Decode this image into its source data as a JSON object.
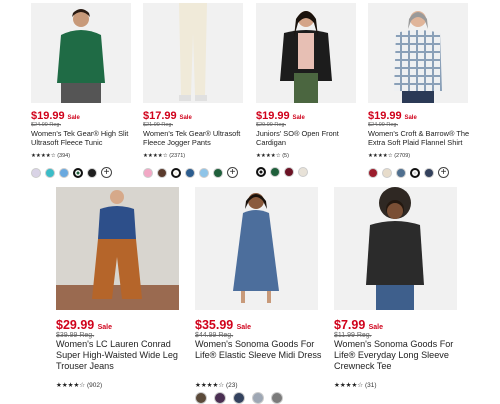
{
  "products": [
    {
      "price": "$19.99",
      "sale": "Sale",
      "regular": "$24.99 Reg.",
      "name": "Women's Tek Gear® High Slit Ultrasoft Fleece Tunic",
      "stars": "★★★★☆",
      "reviews": "(394)",
      "swatches": [
        "#d9d3e6",
        "#3bbcc7",
        "#6aa9df",
        "#1f5f3b",
        "#1e1e1e"
      ],
      "selected": 3,
      "more": true
    },
    {
      "price": "$17.99",
      "sale": "Sale",
      "regular": "$21.99 Reg.",
      "name": "Women's Tek Gear® Ultrasoft Fleece Jogger Pants",
      "stars": "★★★★☆",
      "reviews": "(2371)",
      "swatches": [
        "#f2a8c5",
        "#5a3a2c",
        "#f1ece0",
        "#2c5d8f",
        "#8ec4e8",
        "#1f5f3b"
      ],
      "selected": 2,
      "more": true
    },
    {
      "price": "$19.99",
      "sale": "Sale",
      "regular": "$29.99 Reg.",
      "name": "Juniors' SO® Open Front Cardigan",
      "stars": "★★★★☆",
      "reviews": "(5)",
      "swatches": [
        "#141414",
        "#1f5f3b",
        "#6b1224",
        "#e8e2d8"
      ],
      "selected": 0,
      "more": false
    },
    {
      "price": "$19.99",
      "sale": "Sale",
      "regular": "$24.99 Reg.",
      "name": "Women's Croft & Barrow® The Extra Soft Plaid Flannel Shirt",
      "stars": "★★★★☆",
      "reviews": "(2709)",
      "swatches": [
        "#9b1c2c",
        "#e7dccb",
        "#4f6f8f",
        "#d8d8d8",
        "#33415c"
      ],
      "selected": 3,
      "more": true
    },
    {
      "price": "$29.99",
      "sale": "Sale",
      "regular": "$39.99 Reg.",
      "name": "Women's LC Lauren Conrad Super High-Waisted Wide Leg Trouser Jeans",
      "stars": "★★★★☆",
      "reviews": "(902)",
      "swatches": [],
      "selected": -1,
      "more": false
    },
    {
      "price": "$35.99",
      "sale": "Sale",
      "regular": "$44.99 Reg.",
      "name": "Women's Sonoma Goods For Life® Elastic Sleeve Midi Dress",
      "stars": "★★★★☆",
      "reviews": "(23)",
      "swatches": [
        "#5b4a3a",
        "#4a2f52",
        "#34425e",
        "#9ea7b4",
        "#7b7b7b"
      ],
      "selected": -1,
      "more": false
    },
    {
      "price": "$7.99",
      "sale": "Sale",
      "regular": "$11.99 Reg.",
      "name": "Women's Sonoma Goods For Life® Everyday Long Sleeve Crewneck Tee",
      "stars": "★★★★☆",
      "reviews": "(31)",
      "swatches": [],
      "selected": -1,
      "more": false
    }
  ]
}
